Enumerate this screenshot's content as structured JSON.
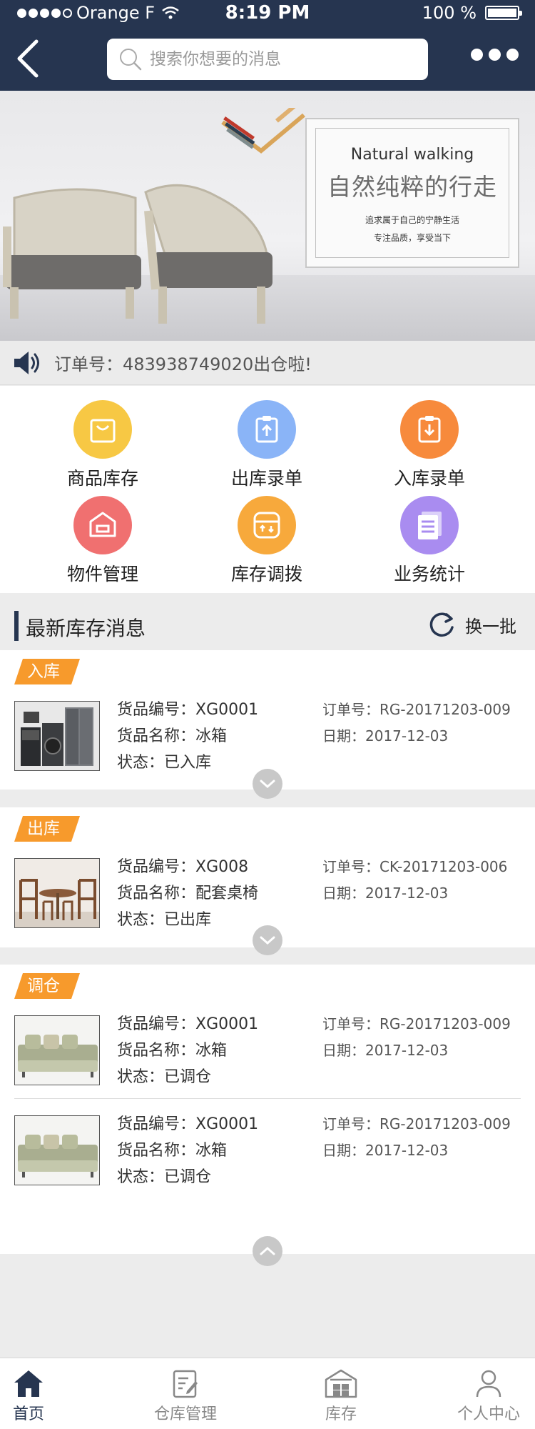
{
  "status_bar": {
    "carrier": "Orange F",
    "time": "8:19 PM",
    "battery": "100 %"
  },
  "header": {
    "search_placeholder": "搜索你想要的消息"
  },
  "banner": {
    "title_en": "Natural walking",
    "title_zh": "自然纯粹的行走",
    "subtitle_1": "追求属于自己的宁静生活",
    "subtitle_2": "专注品质，享受当下"
  },
  "notice": {
    "text": "订单号：483938749020出仓啦!"
  },
  "menu": [
    {
      "label": "商品库存",
      "icon": "shopping-bag-icon",
      "color": "#f7c844"
    },
    {
      "label": "出库录单",
      "icon": "clipboard-out-icon",
      "color": "#8ab4f7"
    },
    {
      "label": "入库录单",
      "icon": "clipboard-in-icon",
      "color": "#f78a3c"
    },
    {
      "label": "物件管理",
      "icon": "box-icon",
      "color": "#f07070"
    },
    {
      "label": "库存调拨",
      "icon": "transfer-icon",
      "color": "#f7a93c"
    },
    {
      "label": "业务统计",
      "icon": "document-stats-icon",
      "color": "#a98cf0"
    }
  ],
  "section": {
    "title": "最新库存消息",
    "refresh_label": "换一批"
  },
  "cards": [
    {
      "tag": "入库",
      "items": [
        {
          "code": "货品编号：XG0001",
          "name": "货品名称：冰箱",
          "status": "状态：已入库",
          "order": "订单号：RG-20171203-009",
          "date": "日期：2017-12-03",
          "image": "appliances"
        }
      ]
    },
    {
      "tag": "出库",
      "items": [
        {
          "code": "货品编号：XG008",
          "name": "货品名称：配套桌椅",
          "status": "状态：已出库",
          "order": "订单号：CK-20171203-006",
          "date": "日期：2017-12-03",
          "image": "table-chairs"
        }
      ]
    },
    {
      "tag": "调仓",
      "items": [
        {
          "code": "货品编号：XG0001",
          "name": "货品名称：冰箱",
          "status": "状态：已调仓",
          "order": "订单号：RG-20171203-009",
          "date": "日期：2017-12-03",
          "image": "sofa"
        },
        {
          "code": "货品编号：XG0001",
          "name": "货品名称：冰箱",
          "status": "状态：已调仓",
          "order": "订单号：RG-20171203-009",
          "date": "日期：2017-12-03",
          "image": "sofa"
        }
      ]
    }
  ],
  "tabbar": [
    {
      "label": "首页",
      "icon": "home-icon",
      "active": true
    },
    {
      "label": "仓库管理",
      "icon": "edit-document-icon",
      "active": false
    },
    {
      "label": "库存",
      "icon": "warehouse-icon",
      "active": false
    },
    {
      "label": "个人中心",
      "icon": "user-icon",
      "active": false
    }
  ]
}
